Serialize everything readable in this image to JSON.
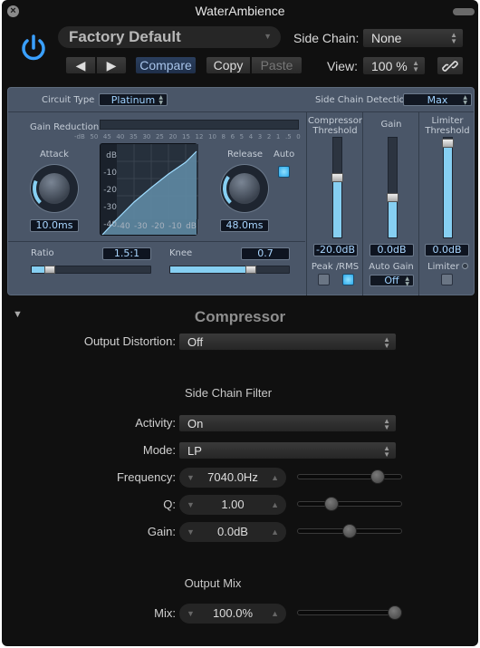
{
  "window": {
    "title": "WaterAmbience"
  },
  "header": {
    "preset": "Factory Default",
    "side_chain_label": "Side Chain:",
    "side_chain_value": "None",
    "compare_label": "Compare",
    "copy_label": "Copy",
    "paste_label": "Paste",
    "view_label": "View:",
    "view_value": "100 %",
    "prev_glyph": "◀",
    "next_glyph": "▶"
  },
  "plugin": {
    "circuit_type_label": "Circuit Type",
    "circuit_type_value": "Platinum",
    "side_chain_detection_label": "Side Chain Detection",
    "side_chain_detection_value": "Max",
    "gain_reduction_label": "Gain Reduction",
    "gain_reduction_scale": [
      "-dB",
      "50",
      "45",
      "40",
      "35",
      "30",
      "25",
      "20",
      "15",
      "12",
      "10",
      "8",
      "6",
      "5",
      "4",
      "3",
      "2",
      "1",
      ".5",
      "0"
    ],
    "attack": {
      "label": "Attack",
      "value": "10.0ms",
      "fraction": 0.25
    },
    "release": {
      "label": "Release",
      "value": "48.0ms",
      "fraction": 0.3
    },
    "auto_label": "Auto",
    "auto_on": true,
    "graph": {
      "y_labels": [
        "dB",
        "-10",
        "-20",
        "-30",
        "-40"
      ],
      "x_labels": [
        "-40",
        "-30",
        "-20",
        "-10",
        "dB"
      ]
    },
    "ratio": {
      "label": "Ratio",
      "value": "1.5:1",
      "fraction": 0.12
    },
    "knee": {
      "label": "Knee",
      "value": "0.7",
      "fraction": 0.7
    },
    "compressor_threshold": {
      "label_line1": "Compressor",
      "label_line2": "Threshold",
      "value": "-20.0dB",
      "fraction": 0.6
    },
    "gain": {
      "label": "Gain",
      "value": "0.0dB",
      "fraction": 0.38
    },
    "limiter_threshold": {
      "label_line1": "Limiter",
      "label_line2": "Threshold",
      "value": "0.0dB",
      "fraction": 0.97
    },
    "peak_rms_label": "Peak /RMS",
    "peak_on": false,
    "rms_on": true,
    "auto_gain_label": "Auto Gain",
    "auto_gain_value": "Off",
    "limiter_label": "Limiter",
    "limiter_on": false
  },
  "extended": {
    "section_title": "Compressor",
    "output_distortion_label": "Output Distortion:",
    "output_distortion_value": "Off",
    "side_chain_filter_header": "Side Chain Filter",
    "activity_label": "Activity:",
    "activity_value": "On",
    "mode_label": "Mode:",
    "mode_value": "LP",
    "frequency_label": "Frequency:",
    "frequency_value": "7040.0Hz",
    "frequency_fraction": 0.81,
    "q_label": "Q:",
    "q_value": "1.00",
    "q_fraction": 0.3,
    "gain_label": "Gain:",
    "gain_value": "0.0dB",
    "gain_fraction": 0.5,
    "output_mix_header": "Output Mix",
    "mix_label": "Mix:",
    "mix_value": "100.0%",
    "mix_fraction": 1.0
  },
  "colors": {
    "accent": "#86cff2",
    "power": "#3aa0ff",
    "panel": "#4a5668"
  }
}
